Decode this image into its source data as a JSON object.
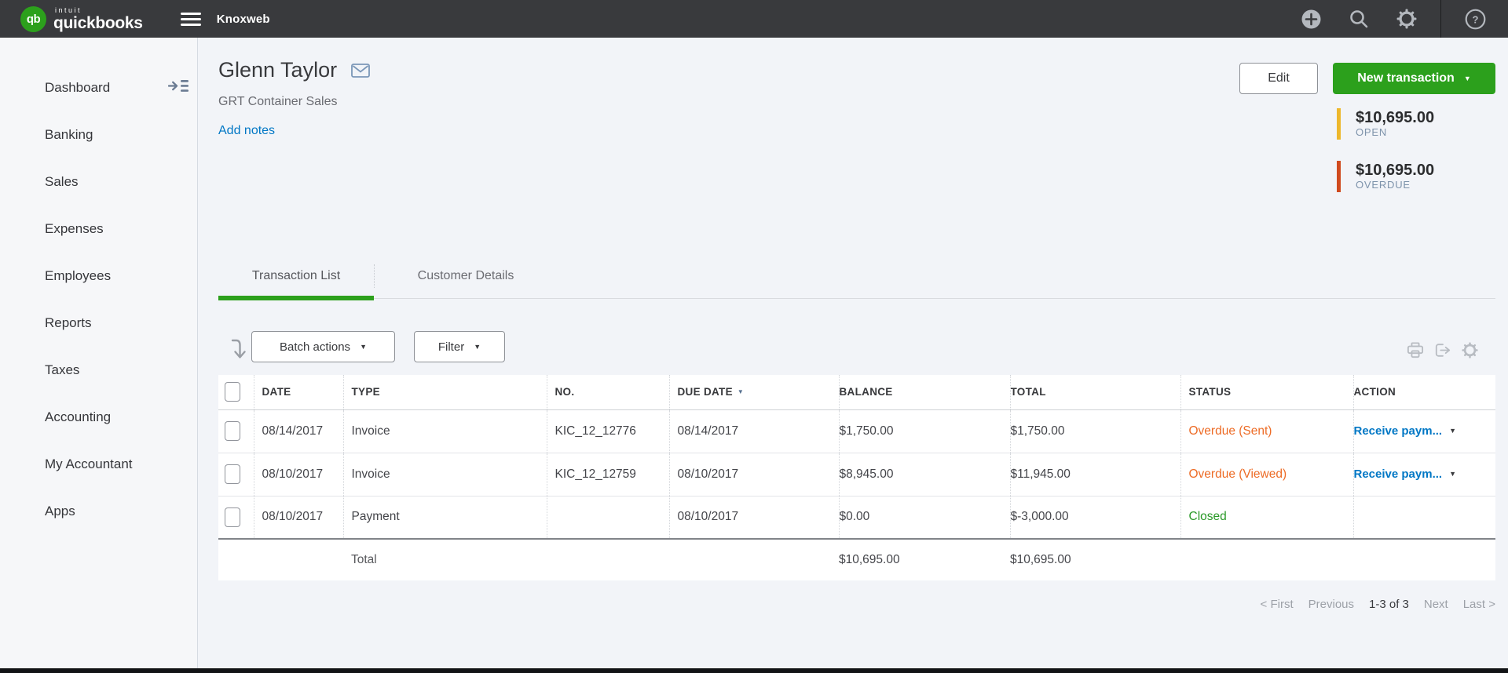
{
  "topbar": {
    "logo_monogram": "qb",
    "brand_small": "intuit",
    "brand": "quickbooks",
    "company": "Knoxweb"
  },
  "icons": {
    "caret_down": "▼",
    "question_mark": "?",
    "add": "plus-circle",
    "search": "magnifier",
    "settings": "gear",
    "help": "question-circle",
    "email": "envelope",
    "collapse_menu": "arrow-into-list",
    "sort": "arrow-down",
    "print": "printer",
    "export": "export-arrow",
    "table_settings": "gear"
  },
  "sidebar": {
    "items": [
      "Dashboard",
      "Banking",
      "Sales",
      "Expenses",
      "Employees",
      "Reports",
      "Taxes",
      "Accounting",
      "My Accountant",
      "Apps"
    ]
  },
  "customer": {
    "name": "Glenn Taylor",
    "company": "GRT Container Sales",
    "add_notes": "Add notes"
  },
  "actions": {
    "edit": "Edit",
    "new_transaction": "New transaction"
  },
  "summary": {
    "open": {
      "amount": "$10,695.00",
      "label": "OPEN",
      "color": "#edb72c"
    },
    "overdue": {
      "amount": "$10,695.00",
      "label": "OVERDUE",
      "color": "#d04a1e"
    }
  },
  "tabs": {
    "transaction_list": "Transaction List",
    "customer_details": "Customer Details"
  },
  "toolbar": {
    "batch_actions": "Batch actions",
    "filter": "Filter"
  },
  "table": {
    "columns": {
      "date": "DATE",
      "type": "TYPE",
      "no": "NO.",
      "due_date": "DUE DATE",
      "balance": "BALANCE",
      "total": "TOTAL",
      "status": "STATUS",
      "action": "ACTION"
    },
    "rows": [
      {
        "date": "08/14/2017",
        "type": "Invoice",
        "no": "KIC_12_12776",
        "due_date": "08/14/2017",
        "balance": "$1,750.00",
        "total": "$1,750.00",
        "status": "Overdue (Sent)",
        "status_color": "#ed6b25",
        "action": "Receive paym..."
      },
      {
        "date": "08/10/2017",
        "type": "Invoice",
        "no": "KIC_12_12759",
        "due_date": "08/10/2017",
        "balance": "$8,945.00",
        "total": "$11,945.00",
        "status": "Overdue (Viewed)",
        "status_color": "#ed6b25",
        "action": "Receive paym..."
      },
      {
        "date": "08/10/2017",
        "type": "Payment",
        "no": "",
        "due_date": "08/10/2017",
        "balance": "$0.00",
        "total": "$-3,000.00",
        "status": "Closed",
        "status_color": "#2a9928",
        "action": ""
      }
    ],
    "total_row": {
      "label": "Total",
      "balance": "$10,695.00",
      "total": "$10,695.00"
    }
  },
  "pagination": {
    "first": "< First",
    "previous": "Previous",
    "range": "1-3 of 3",
    "next": "Next",
    "last": "Last >"
  },
  "colors": {
    "brand_green": "#2ca01c",
    "link_blue": "#0077c5",
    "overdue_orange": "#ed6b25",
    "closed_green": "#2a9928",
    "open_yellow": "#edb72c",
    "overdue_red": "#d04a1e",
    "topbar_bg": "#393a3d"
  }
}
